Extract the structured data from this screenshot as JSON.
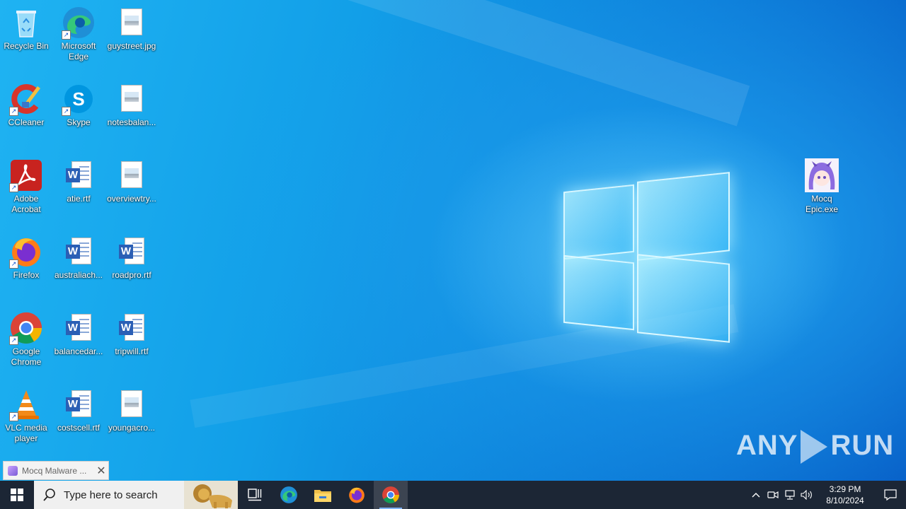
{
  "desktop": {
    "icons": [
      {
        "label": "Recycle Bin",
        "icon": "recycle-bin-icon"
      },
      {
        "label": "Microsoft Edge",
        "icon": "edge-icon"
      },
      {
        "label": "guystreet.jpg",
        "icon": "image-file-icon"
      },
      {
        "label": "CCleaner",
        "icon": "ccleaner-icon"
      },
      {
        "label": "Skype",
        "icon": "skype-icon"
      },
      {
        "label": "notesbalan...",
        "icon": "image-file-icon"
      },
      {
        "label": "Adobe Acrobat",
        "icon": "acrobat-icon"
      },
      {
        "label": "atie.rtf",
        "icon": "word-file-icon"
      },
      {
        "label": "overviewtry...",
        "icon": "image-file-icon"
      },
      {
        "label": "Firefox",
        "icon": "firefox-icon"
      },
      {
        "label": "australiach...",
        "icon": "word-file-icon"
      },
      {
        "label": "roadpro.rtf",
        "icon": "word-file-icon"
      },
      {
        "label": "Google Chrome",
        "icon": "chrome-icon"
      },
      {
        "label": "balancedar...",
        "icon": "word-file-icon"
      },
      {
        "label": "tripwill.rtf",
        "icon": "word-file-icon"
      },
      {
        "label": "VLC media player",
        "icon": "vlc-icon"
      },
      {
        "label": "costscell.rtf",
        "icon": "word-file-icon"
      },
      {
        "label": "youngacro...",
        "icon": "image-file-icon"
      },
      {
        "label": "Mocq Epic.exe",
        "icon": "mocq-app-icon"
      }
    ],
    "watermark": {
      "left": "ANY",
      "right": "RUN"
    }
  },
  "notification": {
    "title": "Mocq Malware ...",
    "close": "✕"
  },
  "taskbar": {
    "search_placeholder": "Type here to search",
    "apps": [
      "Microsoft Edge",
      "File Explorer",
      "Firefox",
      "Google Chrome"
    ]
  },
  "tray": {
    "time": "3:29 PM",
    "date": "8/10/2024"
  }
}
